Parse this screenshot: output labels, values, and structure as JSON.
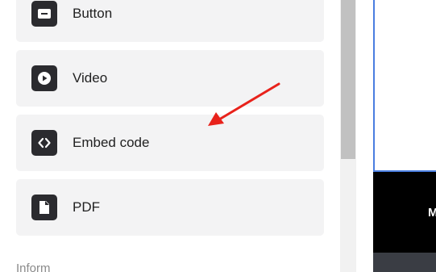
{
  "blocks": [
    {
      "label": "Button",
      "icon": "button-icon"
    },
    {
      "label": "Video",
      "icon": "play-icon"
    },
    {
      "label": "Embed code",
      "icon": "code-icon"
    },
    {
      "label": "PDF",
      "icon": "file-icon"
    }
  ],
  "section_heading": "Inform",
  "preview": {
    "visible_text": "M"
  },
  "colors": {
    "tile_bg": "#f3f3f4",
    "icon_bg": "#2b2b2f",
    "annotation_arrow": "#e8221b",
    "canvas_border": "#4a7ee0"
  }
}
